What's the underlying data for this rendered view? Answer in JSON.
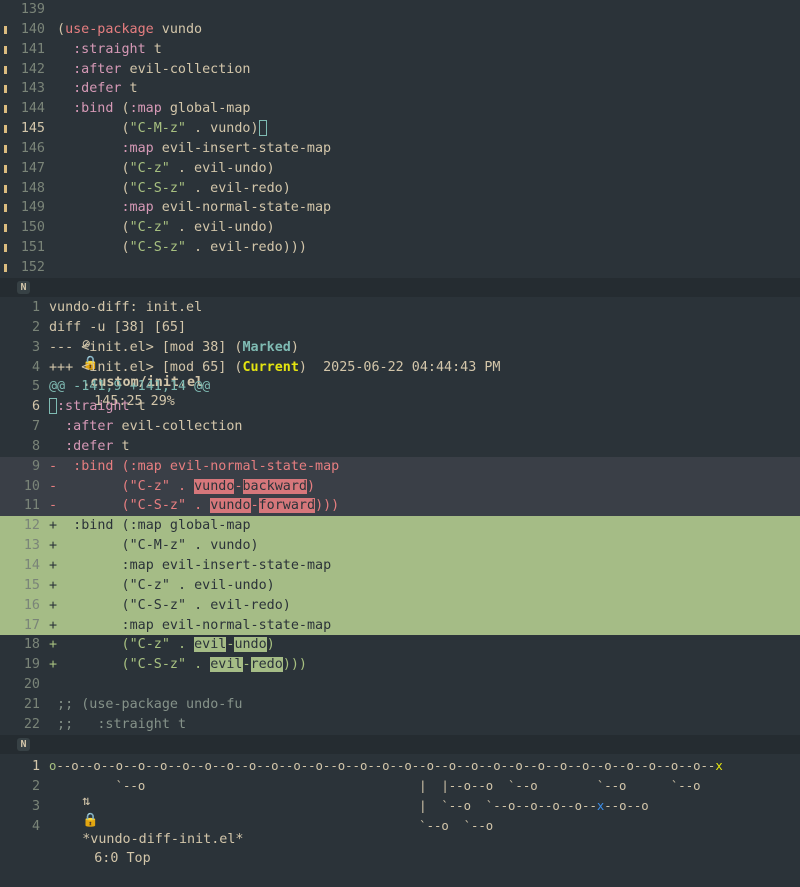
{
  "editor": {
    "lines": [
      {
        "num": "139",
        "text": "",
        "fringe": false
      },
      {
        "num": "140",
        "text": "(use-package vundo",
        "fringe": true
      },
      {
        "num": "141",
        "text": "  :straight t",
        "fringe": true
      },
      {
        "num": "142",
        "text": "  :after evil-collection",
        "fringe": true
      },
      {
        "num": "143",
        "text": "  :defer t",
        "fringe": true
      },
      {
        "num": "144",
        "text": "  :bind (:map global-map",
        "fringe": true
      },
      {
        "num": "145",
        "text": "        (\"C-M-z\" . vundo)",
        "fringe": true
      },
      {
        "num": "146",
        "text": "        :map evil-insert-state-map",
        "fringe": true
      },
      {
        "num": "147",
        "text": "        (\"C-z\" . evil-undo)",
        "fringe": true
      },
      {
        "num": "148",
        "text": "        (\"C-S-z\" . evil-redo)",
        "fringe": true
      },
      {
        "num": "149",
        "text": "        :map evil-normal-state-map",
        "fringe": true
      },
      {
        "num": "150",
        "text": "        (\"C-z\" . evil-undo)",
        "fringe": true
      },
      {
        "num": "151",
        "text": "        (\"C-S-z\" . evil-redo)))",
        "fringe": true
      },
      {
        "num": "152",
        "text": "",
        "fringe": true
      }
    ],
    "modeline": {
      "badge": "N",
      "file": ".custom/init.el",
      "position": "145:25 29%"
    }
  },
  "diff": {
    "lines": [
      {
        "num": "1",
        "text": "vundo-diff: init.el"
      },
      {
        "num": "2",
        "text": "diff -u [38] [65]"
      },
      {
        "num": "3",
        "text": "--- <init.el> [mod 38] (",
        "tag": "Marked",
        "after": ")"
      },
      {
        "num": "4",
        "text": "+++ <init.el> [mod 65] (",
        "tag": "Current",
        "after": ")  2025-06-22 04:44:43 PM"
      },
      {
        "num": "5",
        "text": "@@ -141,9 +141,14 @@"
      },
      {
        "num": "6",
        "text": " :straight t"
      },
      {
        "num": "7",
        "text": "  :after evil-collection"
      },
      {
        "num": "8",
        "text": "  :defer t"
      },
      {
        "num": "9",
        "text": "-  :bind (:map evil-normal-state-map"
      },
      {
        "num": "10",
        "text": "-        (\"C-z\" . vundo-backward)"
      },
      {
        "num": "11",
        "text": "-        (\"C-S-z\" . vundo-forward)))"
      },
      {
        "num": "12",
        "text": "+  :bind (:map global-map"
      },
      {
        "num": "13",
        "text": "+        (\"C-M-z\" . vundo)"
      },
      {
        "num": "14",
        "text": "+        :map evil-insert-state-map"
      },
      {
        "num": "15",
        "text": "+        (\"C-z\" . evil-undo)"
      },
      {
        "num": "16",
        "text": "+        (\"C-S-z\" . evil-redo)"
      },
      {
        "num": "17",
        "text": "+        :map evil-normal-state-map"
      },
      {
        "num": "18",
        "text": "+        (\"C-z\" . evil-undo)"
      },
      {
        "num": "19",
        "text": "+        (\"C-S-z\" . evil-redo)))"
      },
      {
        "num": "20",
        "text": ""
      },
      {
        "num": "21",
        "text": " ;; (use-package undo-fu"
      },
      {
        "num": "22",
        "text": " ;;   :straight t"
      }
    ],
    "modeline": {
      "badge": "N",
      "file": "*vundo-diff-init.el*",
      "position": "6:0 Top"
    }
  },
  "tree": {
    "lines": [
      {
        "num": "1",
        "text": "o--o--o--o--o--o--o--o--o--o--o--o--o--o--o--o--o--o--o--o--o--o--o--o--o--o--o--o--o--o--x"
      },
      {
        "num": "2",
        "text": "         `--o                                     |  |--o--o  `--o        `--o      `--o"
      },
      {
        "num": "3",
        "text": "                                                  |  `--o  `--o--o--o--o--x--o--o"
      },
      {
        "num": "4",
        "text": "                                                  `--o  `--o"
      }
    ]
  },
  "colors": {
    "background": "#2b3339",
    "modeline": "#252c31",
    "added": "#a5bc86",
    "removed": "#d6777b",
    "marked": "#7fbbb3",
    "current": "#e5e510"
  }
}
